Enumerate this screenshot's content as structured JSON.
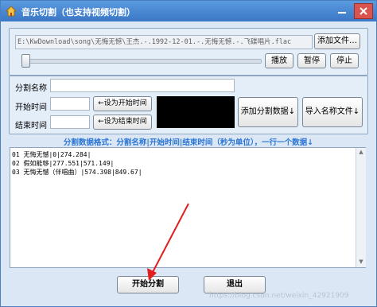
{
  "window": {
    "title": "音乐切割（也支持视频切割）",
    "icon": "house-icon"
  },
  "file": {
    "path": "E:\\KwDownload\\song\\无悔无憾\\王杰.-.1992-12-01.-.无悔无憾.-.飞碟唱片.flac",
    "add_label": "添加文件…"
  },
  "player": {
    "play_label": "播放",
    "pause_label": "暂停",
    "stop_label": "停止"
  },
  "segment": {
    "name_label": "分割名称",
    "name_value": "",
    "start_label": "开始时间",
    "start_value": "",
    "end_label": "结束时间",
    "end_value": "",
    "set_start_label": "←设为开始时间",
    "set_end_label": "←设为结束时间",
    "add_segment_label": "添加分割数据↓",
    "import_label": "导入名称文件↓"
  },
  "format_hint": "分割数据格式：分割名称|开始时间|结束时间（秒为单位），一行一个数据↓",
  "segments_text": [
    "01 无悔无憾|0|274.284|",
    "02 假如能够|277.551|571.149|",
    "03 无悔无憾（伴唱曲）|574.398|849.67|"
  ],
  "actions": {
    "start_label": "开始分割",
    "exit_label": "退出"
  },
  "watermark": "https://blog.csdn.net/weixin_42921909",
  "colors": {
    "titlebar": "#3a77c6",
    "hint": "#2b76d2",
    "annotation_arrow": "#e02020"
  }
}
